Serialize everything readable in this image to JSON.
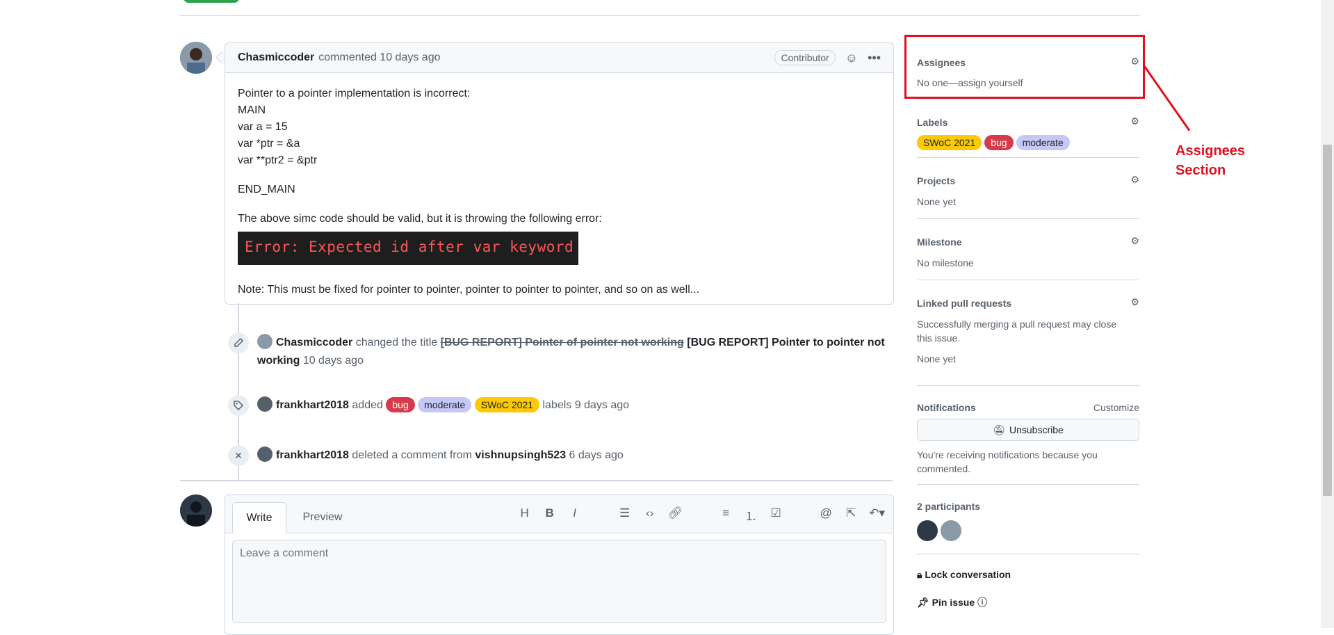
{
  "comment": {
    "author": "Chasmiccoder",
    "meta": "commented 10 days ago",
    "role_badge": "Contributor",
    "lines": [
      "Pointer to a pointer implementation is incorrect:",
      "MAIN",
      "var a = 15",
      "var *ptr = &a",
      "var **ptr2 = &ptr"
    ],
    "end_main": "END_MAIN",
    "error_intro": "The above simc code should be valid, but it is throwing the following error:",
    "error_text": "Error: Expected id after var keyword",
    "note": "Note: This must be fixed for pointer to pointer, pointer to pointer to pointer, and so on as well..."
  },
  "events": [
    {
      "icon": "pencil-icon",
      "actor": "Chasmiccoder",
      "action": "changed the title",
      "old_title": "[BUG REPORT] Pointer of pointer not working",
      "new_title": "[BUG REPORT] Pointer to pointer not working",
      "time": "10 days ago"
    },
    {
      "icon": "tag-icon",
      "actor": "frankhart2018",
      "action": "added",
      "labels": [
        "bug",
        "moderate",
        "SWoC 2021"
      ],
      "suffix": "labels",
      "time": "9 days ago"
    },
    {
      "icon": "x-icon",
      "actor": "frankhart2018",
      "action": "deleted a comment from",
      "target": "vishnupsingh523",
      "time": "6 days ago"
    }
  ],
  "compose": {
    "tab_write": "Write",
    "tab_preview": "Preview",
    "placeholder": "Leave a comment",
    "toolbar": [
      "H",
      "B",
      "I",
      "quote-icon",
      "code-icon",
      "link-icon",
      "bulleted-list-icon",
      "numbered-list-icon",
      "task-list-icon",
      "mention-icon",
      "reference-icon",
      "reply-icon"
    ]
  },
  "sidebar": {
    "assignees": {
      "title": "Assignees",
      "value": "No one—assign yourself"
    },
    "labels": {
      "title": "Labels",
      "items": [
        "SWoC 2021",
        "bug",
        "moderate"
      ]
    },
    "projects": {
      "title": "Projects",
      "value": "None yet"
    },
    "milestone": {
      "title": "Milestone",
      "value": "No milestone"
    },
    "linked_prs": {
      "title": "Linked pull requests",
      "desc": "Successfully merging a pull request may close this issue.",
      "value": "None yet"
    },
    "notifications": {
      "title": "Notifications",
      "customize": "Customize",
      "unsubscribe": "Unsubscribe",
      "reason": "You're receiving notifications because you commented."
    },
    "participants": {
      "title": "2 participants"
    },
    "lock": "Lock conversation",
    "pin": "Pin issue"
  },
  "annotation": {
    "line1": "Assignees",
    "line2": "Section",
    "color": "#e0101e"
  },
  "colors": {
    "bug": "#d73a4a",
    "moderate": "#c5c8f7",
    "swoc": "#fbca04"
  }
}
